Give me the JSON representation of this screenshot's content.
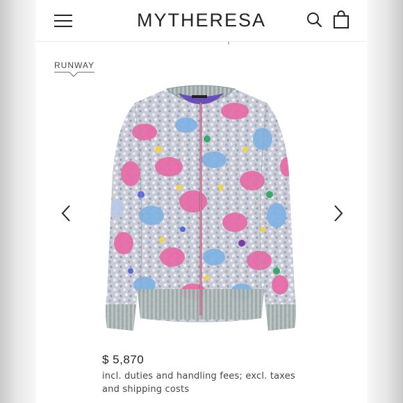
{
  "header": {
    "brand": "MYTHERESA",
    "menu_icon": "hamburger-menu-icon",
    "search_icon": "search-icon",
    "bag_icon": "shopping-bag-icon"
  },
  "badge": {
    "label": "RUNWAY"
  },
  "gallery": {
    "image": "sequin-bomber-jacket",
    "prev_icon": "chevron-left-icon",
    "next_icon": "chevron-right-icon"
  },
  "product": {
    "price": "$ 5,870",
    "fee_note": "incl. duties and handling fees; excl. taxes and shipping costs"
  },
  "colors": {
    "text": "#222222",
    "jacket_pink": "#e86aa8",
    "jacket_blue": "#7fb2e3",
    "jacket_silver": "#cfcfd8"
  }
}
